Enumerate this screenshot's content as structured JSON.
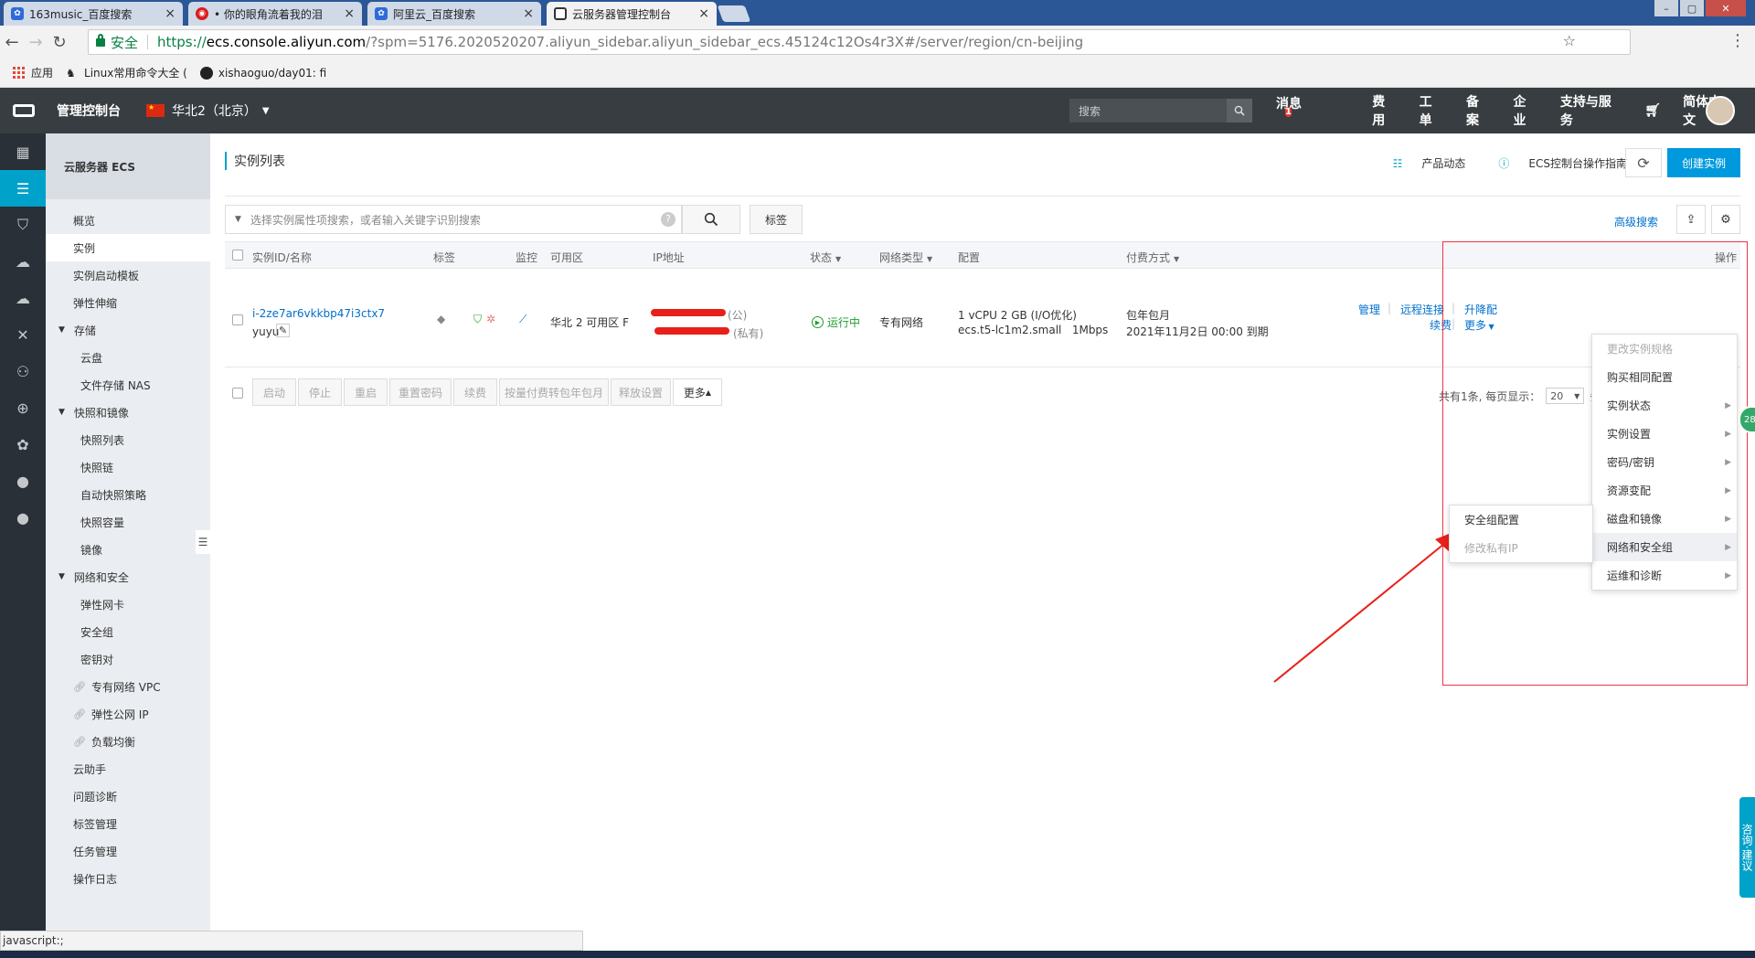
{
  "browser": {
    "tabs": [
      {
        "label": "163music_百度搜索",
        "icon": "baidu-paw-icon",
        "active": false
      },
      {
        "label": "• 你的眼角流着我的泪",
        "icon": "netease-music-icon",
        "active": false
      },
      {
        "label": "阿里云_百度搜索",
        "icon": "baidu-paw-icon",
        "active": false
      },
      {
        "label": "云服务器管理控制台",
        "icon": "aliyun-icon",
        "active": true
      }
    ],
    "secure_label": "安全",
    "url_scheme": "https://",
    "url_host": "ecs.console.aliyun.com",
    "url_path": "/?spm=5176.2020520207.aliyun_sidebar.aliyun_sidebar_ecs.45124c12Os4r3X#/server/region/cn-beijing",
    "bookmarks": [
      {
        "label": "应用",
        "icon": "apps-grid-icon"
      },
      {
        "label": "Linux常用命令大全 (",
        "icon": "penguin-icon"
      },
      {
        "label": "xishaoguo/day01: fi",
        "icon": "github-icon"
      }
    ],
    "status_text": "javascript:;"
  },
  "topnav": {
    "title": "管理控制台",
    "region": "华北2（北京）",
    "search_placeholder": "搜索",
    "links": [
      "消息",
      "费用",
      "工单",
      "备案",
      "企业",
      "支持与服务"
    ],
    "message_badge": "1",
    "language": "简体中文"
  },
  "sidemenu": {
    "title": "云服务器 ECS",
    "items": [
      {
        "label": "概览",
        "type": "item"
      },
      {
        "label": "实例",
        "type": "item",
        "active": true
      },
      {
        "label": "实例启动模板",
        "type": "item"
      },
      {
        "label": "弹性伸缩",
        "type": "item"
      },
      {
        "label": "存储",
        "type": "group"
      },
      {
        "label": "云盘",
        "type": "sub"
      },
      {
        "label": "文件存储 NAS",
        "type": "sub"
      },
      {
        "label": "快照和镜像",
        "type": "group"
      },
      {
        "label": "快照列表",
        "type": "sub"
      },
      {
        "label": "快照链",
        "type": "sub"
      },
      {
        "label": "自动快照策略",
        "type": "sub"
      },
      {
        "label": "快照容量",
        "type": "sub"
      },
      {
        "label": "镜像",
        "type": "sub"
      },
      {
        "label": "网络和安全",
        "type": "group"
      },
      {
        "label": "弹性网卡",
        "type": "sub"
      },
      {
        "label": "安全组",
        "type": "sub"
      },
      {
        "label": "密钥对",
        "type": "sub"
      },
      {
        "label": "专有网络 VPC",
        "type": "link"
      },
      {
        "label": "弹性公网 IP",
        "type": "link"
      },
      {
        "label": "负载均衡",
        "type": "link"
      },
      {
        "label": "云助手",
        "type": "item"
      },
      {
        "label": "问题诊断",
        "type": "item"
      },
      {
        "label": "标签管理",
        "type": "item"
      },
      {
        "label": "任务管理",
        "type": "item"
      },
      {
        "label": "操作日志",
        "type": "item"
      }
    ]
  },
  "main": {
    "title": "实例列表",
    "product_news": "产品动态",
    "guide": "ECS控制台操作指南",
    "create_label": "创建实例",
    "search_placeholder": "选择实例属性项搜索，或者输入关键字识别搜索",
    "tag_button": "标签",
    "advanced_search": "高级搜索",
    "columns": {
      "id": "实例ID/名称",
      "tag": "标签",
      "monitor": "监控",
      "zone": "可用区",
      "ip": "IP地址",
      "status": "状态",
      "network": "网络类型",
      "config": "配置",
      "billing": "付费方式",
      "ops": "操作"
    },
    "instance": {
      "id": "i-2ze7ar6vkkbp47i3ctx7",
      "name": "yuyu",
      "zone": "华北 2 可用区 F",
      "ip_public_suffix": "(公)",
      "ip_private_suffix": "(私有)",
      "status": "运行中",
      "network": "专有网络",
      "config_line1": "1 vCPU 2 GB (I/O优化)",
      "config_line2": "ecs.t5-lc1m2.small   1Mbps",
      "billing_line1": "包年包月",
      "billing_line2": "2021年11月2日 00:00 到期",
      "op_manage": "管理",
      "op_remote": "远程连接",
      "op_upgrade": "升降配",
      "op_renew": "续费",
      "op_more": "更多"
    },
    "footer_buttons": [
      "启动",
      "停止",
      "重启",
      "重置密码",
      "续费",
      "按量付费转包年包月",
      "释放设置",
      "更多"
    ],
    "pager_text": "共有1条, 每页显示：",
    "page_size": "20",
    "pager_unit": "条"
  },
  "more_menu": {
    "items": [
      {
        "label": "更改实例规格",
        "disabled": true,
        "submenu": false
      },
      {
        "label": "购买相同配置",
        "disabled": false,
        "submenu": false
      },
      {
        "label": "实例状态",
        "disabled": false,
        "submenu": true
      },
      {
        "label": "实例设置",
        "disabled": false,
        "submenu": true
      },
      {
        "label": "密码/密钥",
        "disabled": false,
        "submenu": true
      },
      {
        "label": "资源变配",
        "disabled": false,
        "submenu": true
      },
      {
        "label": "磁盘和镜像",
        "disabled": false,
        "submenu": true
      },
      {
        "label": "网络和安全组",
        "disabled": false,
        "submenu": true,
        "highlighted": true
      },
      {
        "label": "运维和诊断",
        "disabled": false,
        "submenu": true
      }
    ]
  },
  "sub_menu": {
    "items": [
      {
        "label": "安全组配置",
        "disabled": false
      },
      {
        "label": "修改私有IP",
        "disabled": true
      }
    ]
  },
  "floaters": {
    "consult": "咨询·建议",
    "green_badge": "28"
  },
  "colors": {
    "topnav_bg": "#373d41",
    "rail_bg": "#293038",
    "accent": "#00a2ca",
    "primary_button": "#0099dd",
    "link": "#0070cc",
    "running": "#1e9e2e",
    "annotation_red": "#e8201a"
  }
}
